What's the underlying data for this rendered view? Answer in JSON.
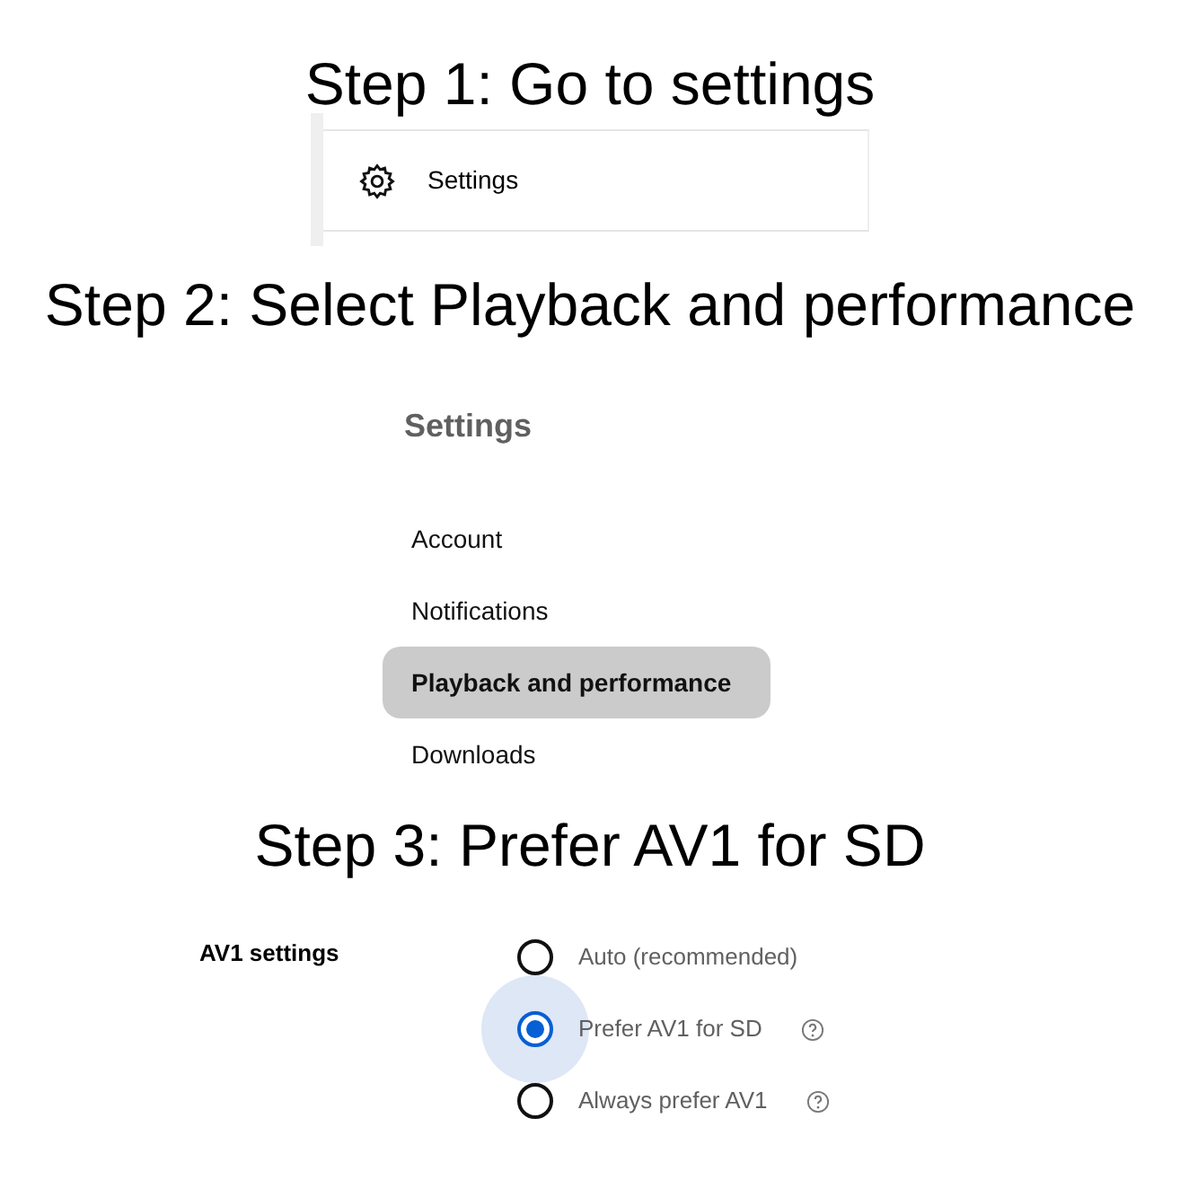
{
  "steps": [
    {
      "kind": "menu",
      "heading": "Step 1: Go to settings",
      "item": "Settings"
    },
    {
      "kind": "sidebar",
      "heading": "Step 2: Select Playback and performance",
      "title": "Settings",
      "items": [
        {
          "label": "Account",
          "selected": false
        },
        {
          "label": "Notifications",
          "selected": false
        },
        {
          "label": "Playback and performance",
          "selected": true
        },
        {
          "label": "Downloads",
          "selected": false
        }
      ]
    },
    {
      "kind": "radios",
      "heading": "Step 3: Prefer AV1 for SD",
      "label": "AV1 settings",
      "options": [
        {
          "label": "Auto (recommended)",
          "selected": false,
          "help_icon": false
        },
        {
          "label": "Prefer AV1 for SD",
          "selected": true,
          "help_icon": true
        },
        {
          "label": "Always prefer AV1",
          "selected": false,
          "help_icon": true
        }
      ]
    }
  ]
}
